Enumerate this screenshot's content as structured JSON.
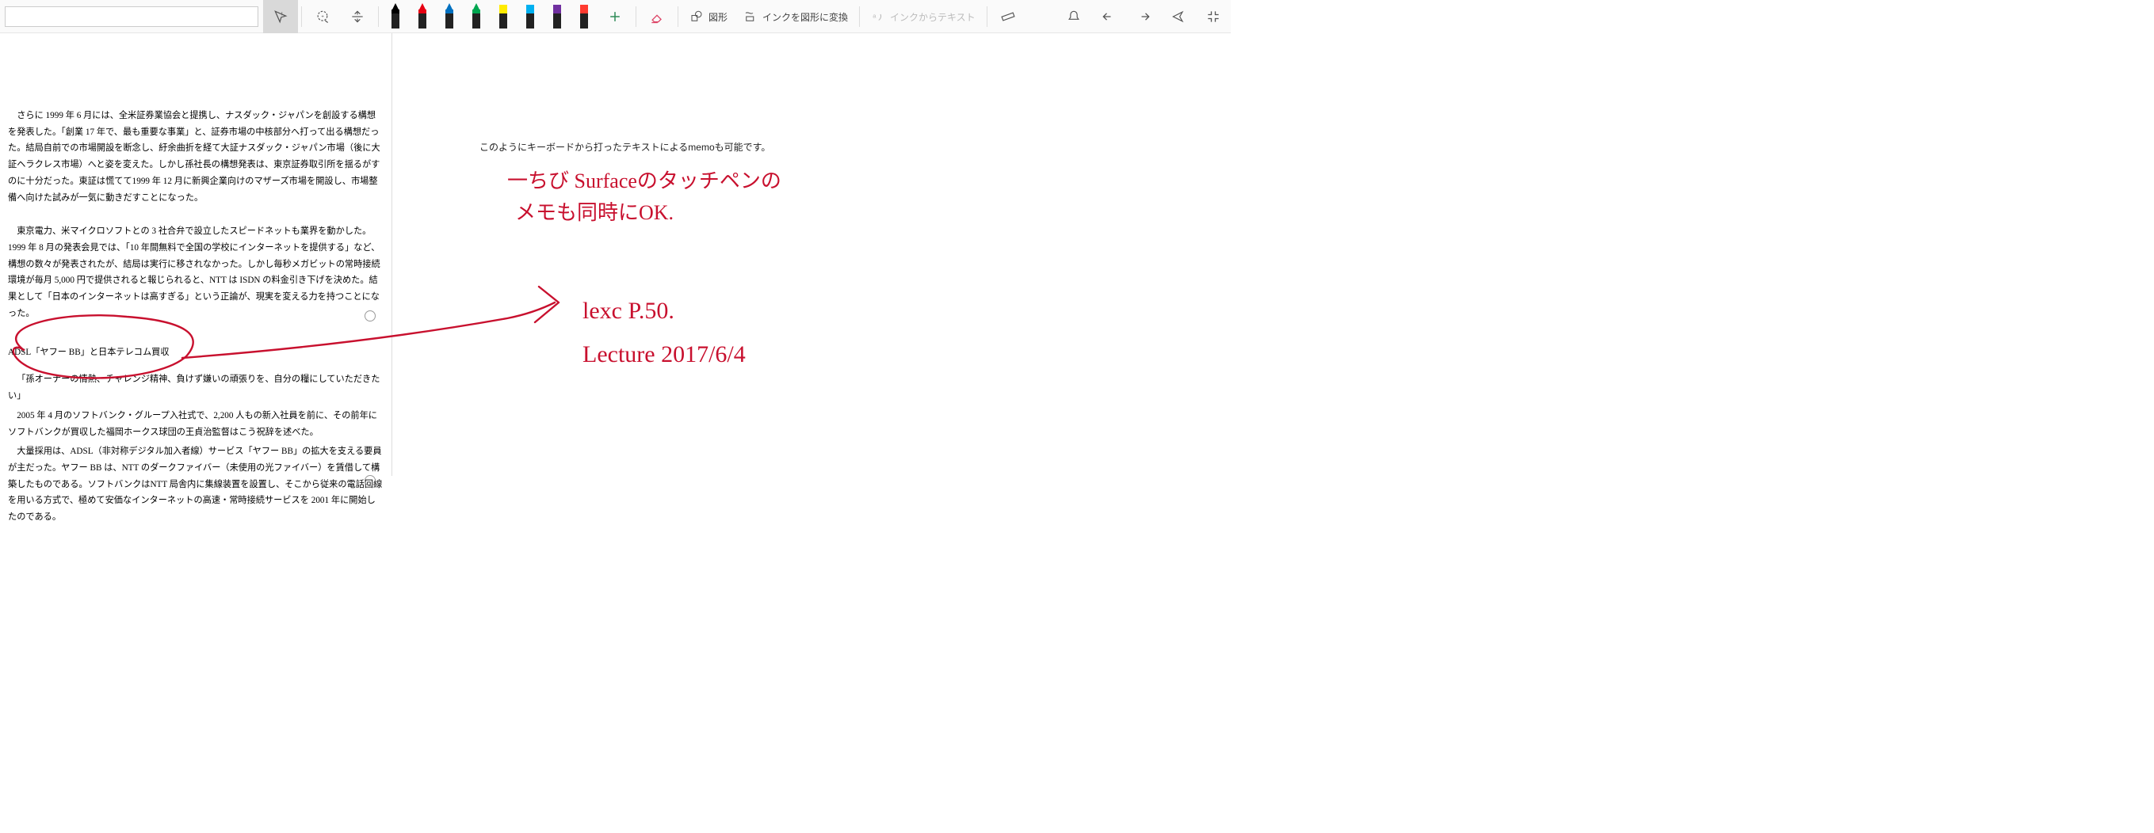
{
  "search": {
    "value": "",
    "placeholder": ""
  },
  "toolbar": {
    "shapes_label": "図形",
    "ink_to_shape_label": "インクを図形に変換",
    "ink_to_text_label": "インクからテキスト",
    "pens": [
      {
        "name": "pen-black",
        "color": "#000000",
        "type": "pen"
      },
      {
        "name": "pen-red",
        "color": "#e60012",
        "type": "pen"
      },
      {
        "name": "pen-blue",
        "color": "#0070c0",
        "type": "pen"
      },
      {
        "name": "pen-green",
        "color": "#00a650",
        "type": "pen"
      },
      {
        "name": "marker-yellow",
        "color": "#ffeb00",
        "type": "marker"
      },
      {
        "name": "marker-blue",
        "color": "#00b0f0",
        "type": "marker"
      },
      {
        "name": "marker-purple",
        "color": "#7030a0",
        "type": "marker"
      },
      {
        "name": "marker-red",
        "color": "#ff3b30",
        "type": "marker"
      }
    ]
  },
  "document": {
    "p1": "さらに 1999 年 6 月には、全米証券業協会と提携し、ナスダック・ジャパンを創設する構想を発表した。「創業 17 年で、最も重要な事業」と、証券市場の中核部分へ打って出る構想だった。結局自前での市場開設を断念し、紆余曲折を経て大証ナスダック・ジャパン市場（後に大証ヘラクレス市場）へと姿を変えた。しかし孫社長の構想発表は、東京証券取引所を揺るがすのに十分だった。東証は慌てて1999 年 12 月に新興企業向けのマザーズ市場を開設し、市場整備へ向けた試みが一気に動きだすことになった。",
    "p2": "東京電力、米マイクロソフトとの 3 社合弁で設立したスピードネットも業界を動かした。1999 年 8 月の発表会見では、「10 年間無料で全国の学校にインターネットを提供する」など、構想の数々が発表されたが、結局は実行に移されなかった。しかし毎秒メガビットの常時接続環境が毎月 5,000 円で提供されると報じられると、NTT は ISDN の料金引き下げを決めた。結果として「日本のインターネットは高すぎる」という正論が、現実を変える力を持つことになった。",
    "heading": "ADSL「ヤフー BB」と日本テレコム買収",
    "p3": "「孫オーナーの情熱、チャレンジ精神、負けず嫌いの頑張りを、自分の糧にしていただきたい」",
    "p4": "2005 年 4 月のソフトバンク・グループ入社式で、2,200 人もの新入社員を前に、その前年にソフトバンクが買収した福岡ホークス球団の王貞治監督はこう祝辞を述べた。",
    "p5": "大量採用は、ADSL（非対称デジタル加入者線）サービス「ヤフー BB」の拡大を支える要員が主だった。ヤフー BB は、NTT のダークファイバー（未使用の光ファイバー）を賃借して構築したものである。ソフトバンクはNTT 局舎内に集線装置を設置し、そこから従来の電話回線を用いる方式で、極めて安価なインターネットの高速・常時接続サービスを 2001 年に開始したのである。"
  },
  "right_panel": {
    "typed_note": "このようにキーボードから打ったテキストによるmemoも可能です。"
  },
  "ink_annotations": {
    "color": "#c8102e",
    "note_line1": "一ちび Surfaceのタッチペンの",
    "note_line2": "メモも同時にOK.",
    "note_line3": "lexc P.50.",
    "note_line4": "Lecture 2017/6/4",
    "circled_text_ref": "document.heading"
  }
}
